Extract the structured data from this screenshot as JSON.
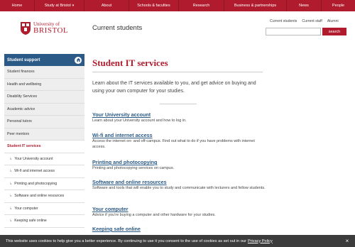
{
  "topnav": [
    {
      "label": "Home"
    },
    {
      "label": "Study at Bristol",
      "has_dropdown": true
    },
    {
      "label": "About"
    },
    {
      "label": "Schools & faculties"
    },
    {
      "label": "Research"
    },
    {
      "label": "Business & partnerships"
    },
    {
      "label": "News"
    },
    {
      "label": "People"
    }
  ],
  "header": {
    "logo_line1": "University of",
    "logo_line2": "BRISTOL",
    "site_title": "Current students",
    "util_links": [
      "Current students",
      "Current staff",
      "Alumni"
    ],
    "search_placeholder": "",
    "search_button": "search"
  },
  "sidebar": {
    "heading": "Student support",
    "items": [
      {
        "label": "Student finances",
        "type": "top"
      },
      {
        "label": "Health and wellbeing",
        "type": "top"
      },
      {
        "label": "Disability Services",
        "type": "top"
      },
      {
        "label": "Academic advice",
        "type": "top"
      },
      {
        "label": "Personal tutors",
        "type": "top"
      },
      {
        "label": "Peer mentors",
        "type": "top"
      },
      {
        "label": "Student IT services",
        "type": "active"
      },
      {
        "label": "Your University account",
        "type": "sub"
      },
      {
        "label": "Wi-fi and internet access",
        "type": "sub"
      },
      {
        "label": "Printing and photocopying",
        "type": "sub"
      },
      {
        "label": "Software and online resources",
        "type": "sub"
      },
      {
        "label": "Your computer",
        "type": "sub"
      },
      {
        "label": "Keeping safe online",
        "type": "sub"
      }
    ]
  },
  "main": {
    "title": "Student IT services",
    "intro": "Learn about the IT services available to you, and get advice on buying and using your own computer for your studies.",
    "sections": [
      {
        "title": "Your University account",
        "desc": "Learn about your University account and how to log in."
      },
      {
        "title": "Wi-fi and internet access",
        "desc": "Access the internet on- and off-campus. Find out what to do if you have problems with internet access."
      },
      {
        "title": "Printing and photocopying",
        "desc": "Printing and photocopying services on campus."
      },
      {
        "title": "Software and online resources",
        "desc": "Software and tools that will enable you to study and communicate with lecturers and fellow students."
      },
      {
        "title": "Your computer",
        "desc": "Advice if you're buying a computer and other hardware for your studies."
      },
      {
        "title": "Keeping safe online",
        "desc": ""
      }
    ]
  },
  "cookie": {
    "text": "This website uses cookies to help give you a better experience. By continuing to use it you consent to the use of cookies as set out in our",
    "policy_link": "Privacy Policy",
    "close_label": "×"
  },
  "colors": {
    "brand_red": "#b01c2e",
    "nav_blue": "#2b5a86",
    "cookie_bg": "#3c3c3c"
  }
}
